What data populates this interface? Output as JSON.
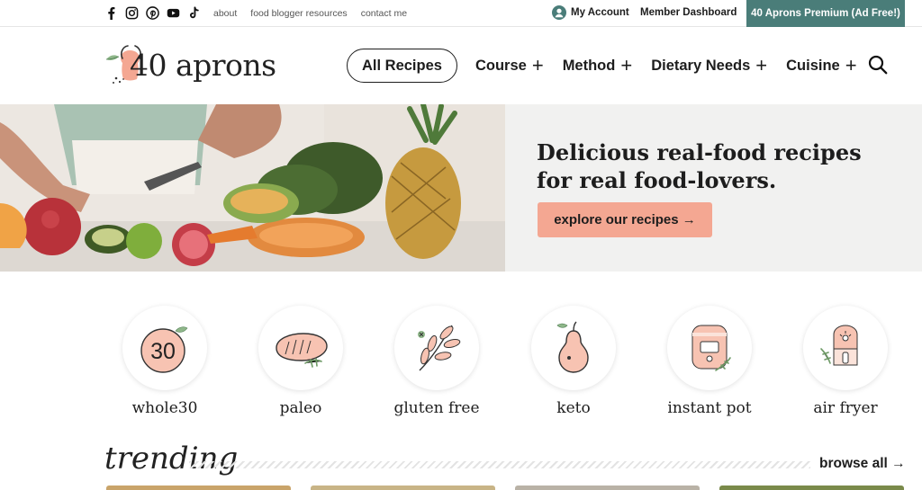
{
  "topbar": {
    "social": [
      {
        "name": "facebook-icon"
      },
      {
        "name": "instagram-icon"
      },
      {
        "name": "pinterest-icon"
      },
      {
        "name": "youtube-icon"
      },
      {
        "name": "tiktok-icon"
      }
    ],
    "links": [
      "about",
      "food blogger resources",
      "contact me"
    ],
    "account_label": "My Account",
    "dashboard_label": "Member Dashboard",
    "premium_label": "40 Aprons Premium (Ad Free!)"
  },
  "header": {
    "logo_text": "40 aprons",
    "nav_pill": "All Recipes",
    "nav_items": [
      "Course",
      "Method",
      "Dietary Needs",
      "Cuisine"
    ],
    "plus_glyph": "+"
  },
  "hero": {
    "headline": "Delicious real-food recipes for real food-lovers.",
    "cta_label": "explore our recipes →"
  },
  "categories": [
    {
      "label": "whole30",
      "icon": "whole30-icon",
      "badge": "30"
    },
    {
      "label": "paleo",
      "icon": "paleo-steak-icon"
    },
    {
      "label": "gluten free",
      "icon": "gluten-free-leaf-icon"
    },
    {
      "label": "keto",
      "icon": "keto-pear-icon"
    },
    {
      "label": "instant pot",
      "icon": "instant-pot-icon"
    },
    {
      "label": "air fryer",
      "icon": "air-fryer-icon"
    }
  ],
  "trending": {
    "title": "trending",
    "browse_label": "browse all →"
  },
  "colors": {
    "accent_teal": "#4a7d79",
    "peach": "#f4a792",
    "hero_bg": "#f1f1f0"
  }
}
